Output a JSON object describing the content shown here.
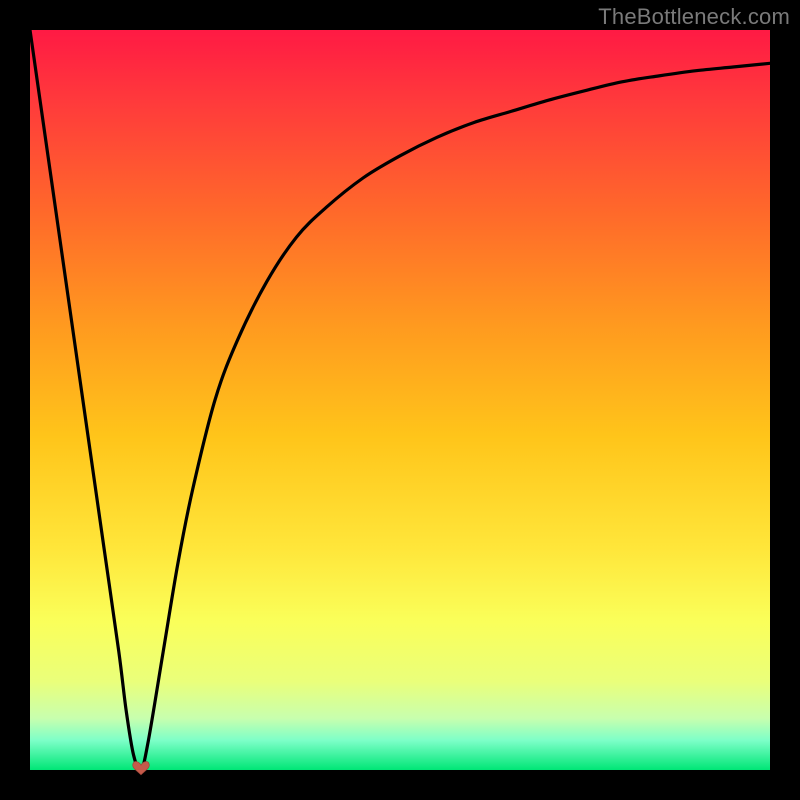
{
  "watermark": "TheBottleneck.com",
  "colors": {
    "frame": "#000000",
    "gradient_top": "#ff1a44",
    "gradient_bottom": "#00e676",
    "curve": "#000000",
    "marker": "#c55a4a"
  },
  "chart_data": {
    "type": "line",
    "title": "",
    "xlabel": "",
    "ylabel": "",
    "xlim": [
      0,
      100
    ],
    "ylim": [
      0,
      100
    ],
    "grid": false,
    "x": [
      0,
      2,
      4,
      6,
      8,
      10,
      12,
      13,
      14,
      15,
      16,
      18,
      20,
      22,
      25,
      28,
      32,
      36,
      40,
      45,
      50,
      55,
      60,
      65,
      70,
      75,
      80,
      85,
      90,
      95,
      100
    ],
    "y": [
      100,
      86,
      72,
      58,
      44,
      30,
      16,
      8,
      2,
      0,
      4,
      16,
      28,
      38,
      50,
      58,
      66,
      72,
      76,
      80,
      83,
      85.5,
      87.5,
      89,
      90.5,
      91.8,
      93,
      93.8,
      94.5,
      95,
      95.5
    ],
    "marker": {
      "x": 15,
      "y": 0,
      "shape": "heart"
    }
  }
}
